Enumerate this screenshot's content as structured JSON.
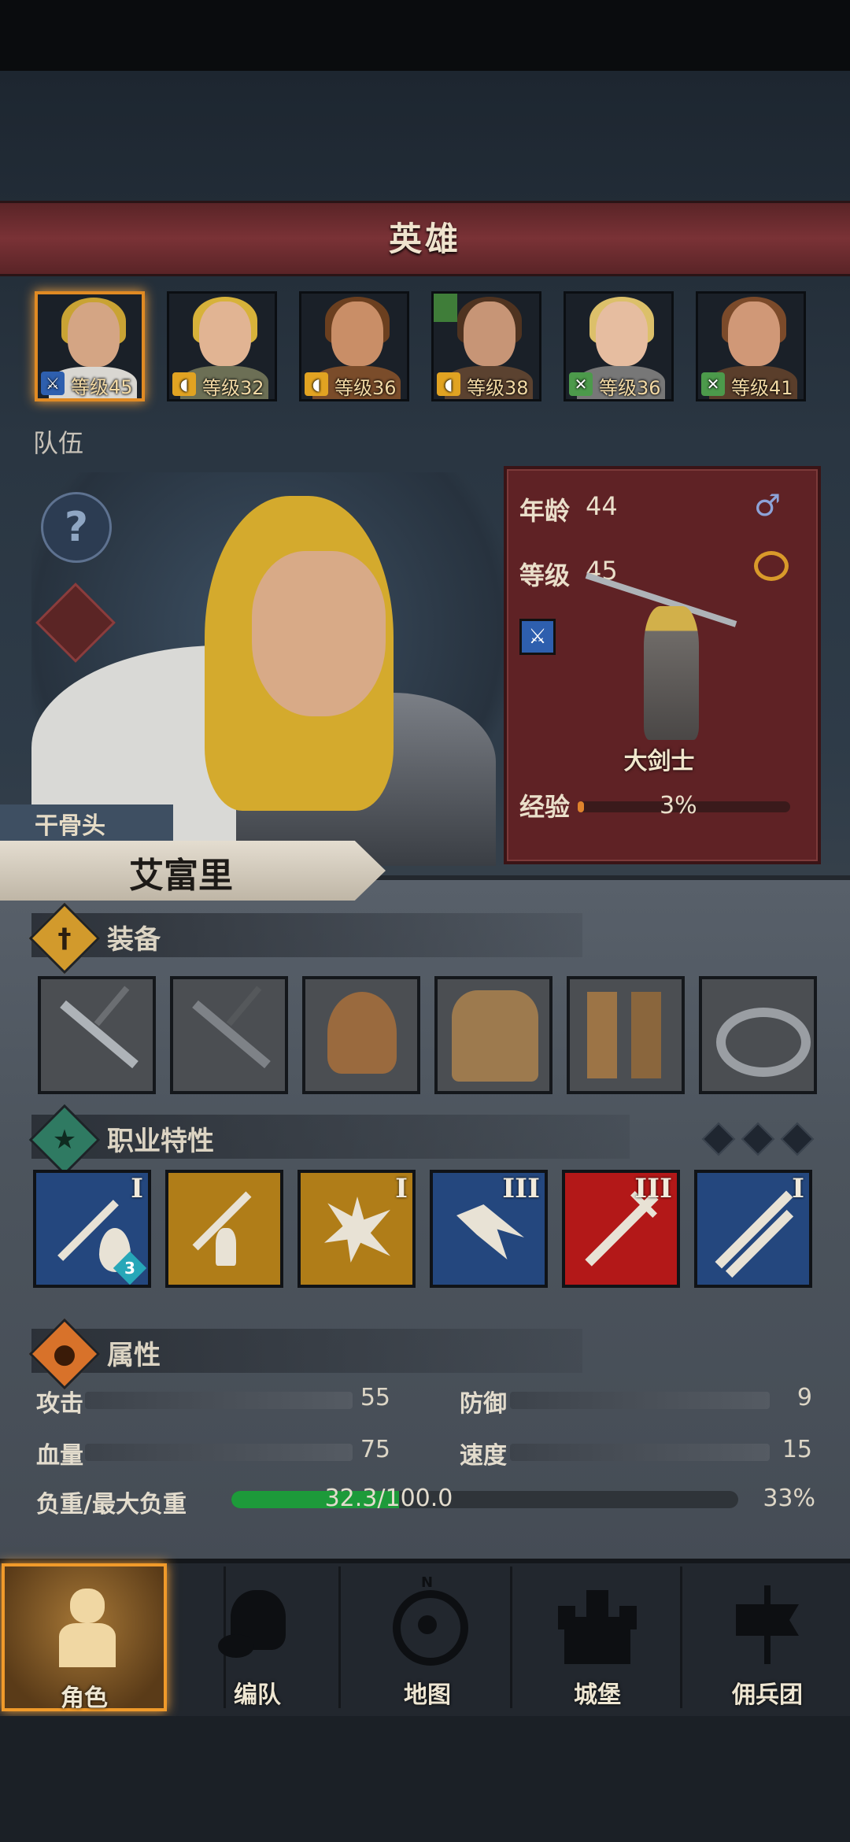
{
  "header": {
    "title": "英雄"
  },
  "heroes": [
    {
      "level_text": "等级45",
      "class_badge": "sword"
    },
    {
      "level_text": "等级32",
      "class_badge": "shield"
    },
    {
      "level_text": "等级36",
      "class_badge": "shield"
    },
    {
      "level_text": "等级38",
      "class_badge": "shield"
    },
    {
      "level_text": "等级36",
      "class_badge": "cross"
    },
    {
      "level_text": "等级41",
      "class_badge": "cross"
    }
  ],
  "team_label": "队伍",
  "info": {
    "age_label": "年龄",
    "age_value": "44",
    "level_label": "等级",
    "level_value": "45",
    "class_name": "大剑士",
    "exp_label": "经验",
    "exp_value": "3%",
    "exp_fraction": 0.03
  },
  "character": {
    "nickname": "干骨头",
    "name": "艾富里"
  },
  "sections": {
    "equipment": "装备",
    "traits": "职业特性",
    "attributes": "属性"
  },
  "equipment_slots": [
    "sword-icon",
    "sword-icon",
    "helmet-icon",
    "armor-icon",
    "boots-icon",
    "ring-icon"
  ],
  "traits": [
    {
      "icon": "sword-drop-icon",
      "rank": "I",
      "badge": "3"
    },
    {
      "icon": "sword-aura-icon",
      "rank": ""
    },
    {
      "icon": "burst-icon",
      "rank": "I"
    },
    {
      "icon": "wing-icon",
      "rank": "III"
    },
    {
      "icon": "sword-strike-icon",
      "rank": "III"
    },
    {
      "icon": "crossed-swords-icon",
      "rank": "I"
    }
  ],
  "stats": {
    "attack_label": "攻击",
    "attack_value": "55",
    "defense_label": "防御",
    "defense_value": "9",
    "hp_label": "血量",
    "hp_value": "75",
    "speed_label": "速度",
    "speed_value": "15",
    "load_label": "负重/最大负重",
    "load_value": "32.3/100.0",
    "load_percent": "33%",
    "load_fraction": 0.33
  },
  "nav": [
    {
      "label": "角色",
      "icon": "knight-icon",
      "active": true
    },
    {
      "label": "编队",
      "icon": "helmet-icon",
      "active": false
    },
    {
      "label": "地图",
      "icon": "compass-icon",
      "active": false
    },
    {
      "label": "城堡",
      "icon": "castle-icon",
      "active": false
    },
    {
      "label": "佣兵团",
      "icon": "banner-icon",
      "active": false
    }
  ],
  "colors": {
    "accent": "#e08a23",
    "panel": "#5f2225",
    "load_bar": "#1d9a3a"
  }
}
